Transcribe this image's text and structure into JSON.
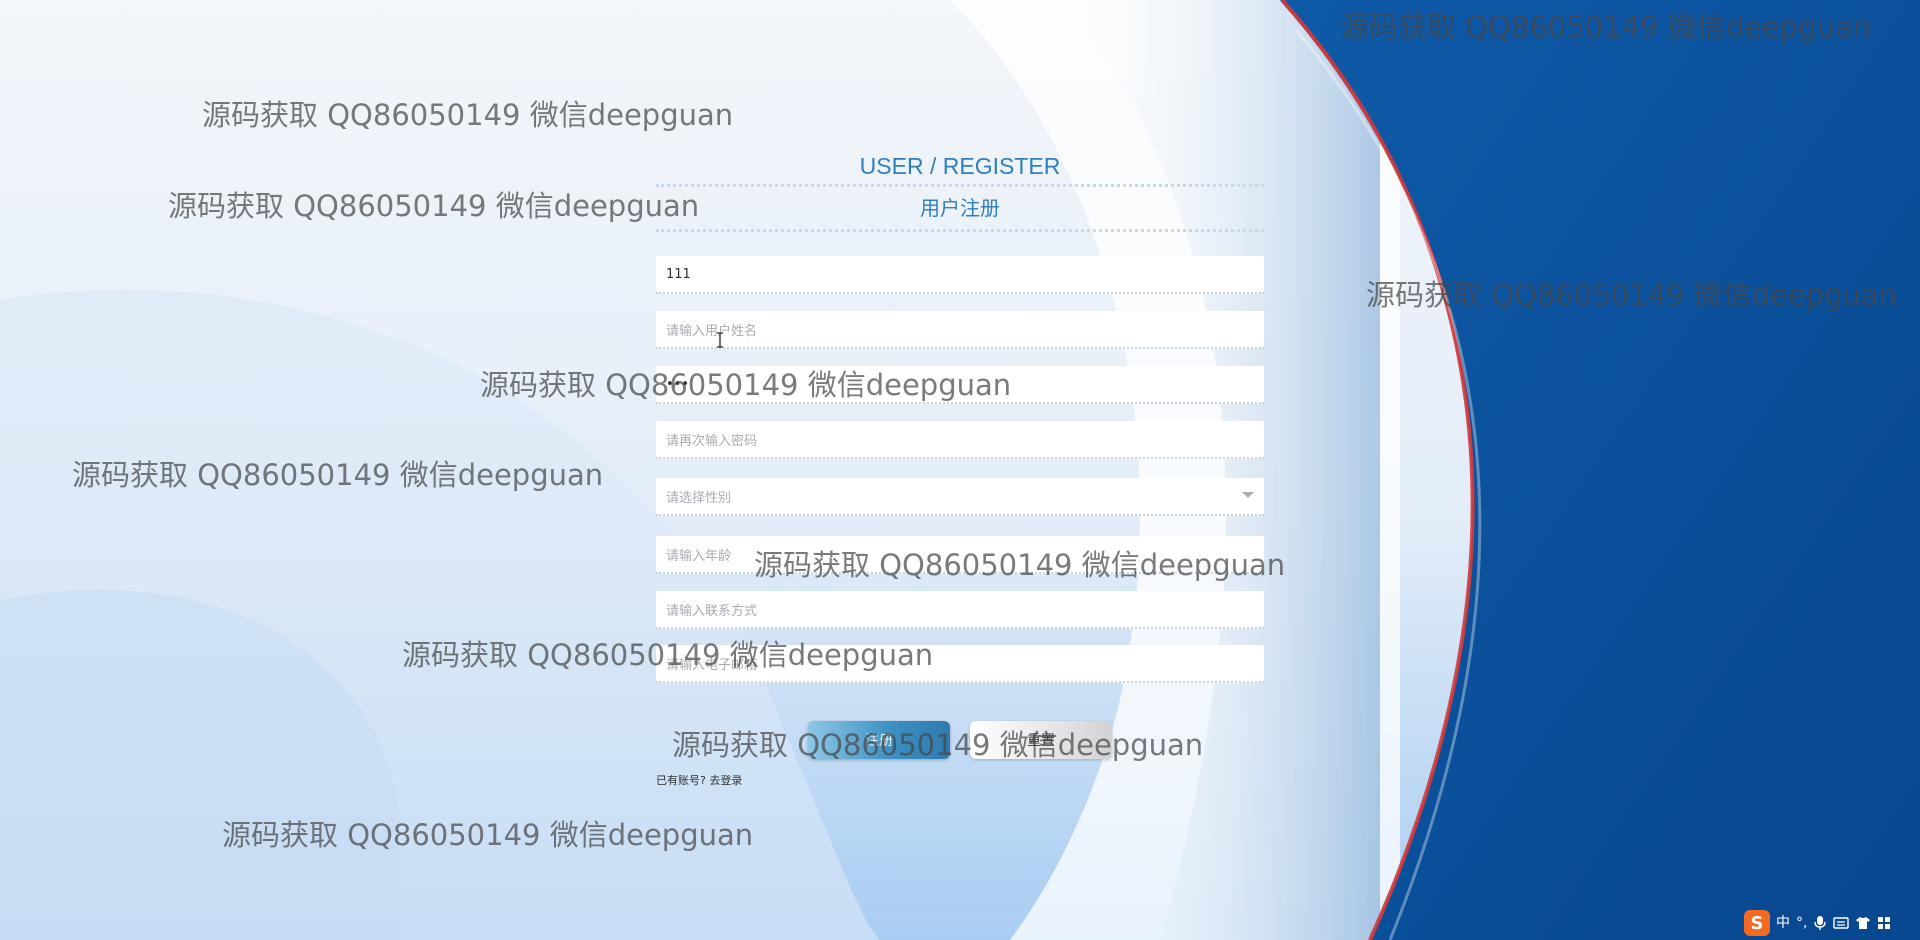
{
  "form": {
    "title": "USER / REGISTER",
    "subtitle": "用户注册",
    "fields": {
      "username": {
        "value": "111",
        "placeholder": ""
      },
      "name": {
        "value": "",
        "placeholder": "请输入用户姓名"
      },
      "password": {
        "value": "•••",
        "placeholder": ""
      },
      "confirm_password": {
        "value": "",
        "placeholder": "请再次输入密码"
      },
      "gender": {
        "value": "",
        "placeholder": "请选择性别"
      },
      "age": {
        "value": "",
        "placeholder": "请输入年龄"
      },
      "phone": {
        "value": "",
        "placeholder": "请输入联系方式"
      },
      "email": {
        "value": "",
        "placeholder": "请输入电子邮箱"
      }
    },
    "buttons": {
      "register": "注册",
      "reset": "重置"
    },
    "login_prompt": "已有账号?",
    "login_link": "去登录"
  },
  "watermark": {
    "text": "源码获取 QQ86050149 微信deepguan"
  },
  "tray": {
    "ime_logo": "S",
    "ime_mode": "中",
    "punct": "°,",
    "mic_icon": "mic-icon",
    "keyboard_icon": "keyboard-icon",
    "skin_icon": "shirt-icon",
    "apps_icon": "grid-icon"
  },
  "colors": {
    "accent": "#2f7fbf",
    "right_panel": "#0a4f9e",
    "curve_red": "#d23a3a"
  }
}
